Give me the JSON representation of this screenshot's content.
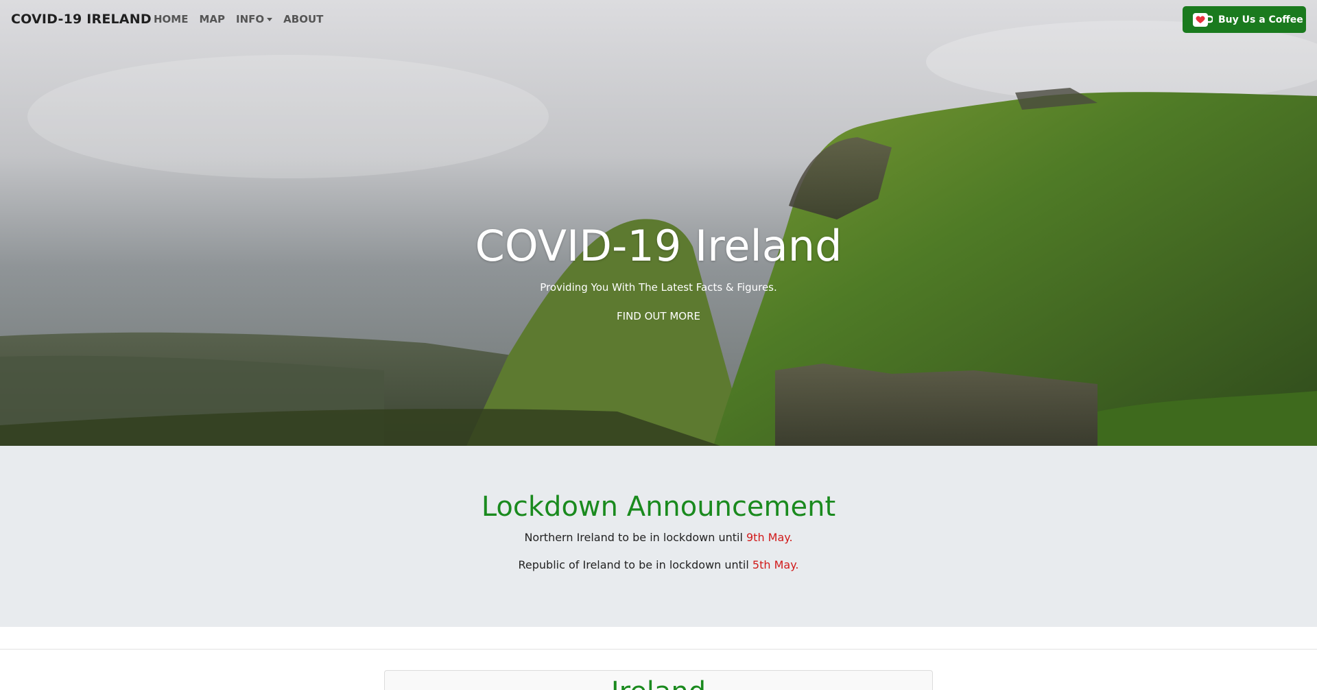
{
  "navbar": {
    "brand": "COVID-19 IRELAND",
    "links": [
      {
        "label": "HOME"
      },
      {
        "label": "MAP"
      },
      {
        "label": "INFO"
      },
      {
        "label": "ABOUT"
      }
    ],
    "coffee_button": {
      "label": "Buy Us a Coffee",
      "icon": "coffee-cup-heart-icon"
    }
  },
  "hero": {
    "title": "COVID-19 Ireland",
    "subtitle": "Providing You With The Latest Facts & Figures.",
    "cta": "FIND OUT MORE"
  },
  "lockdown": {
    "title": "Lockdown Announcement",
    "lines": [
      {
        "text": "Northern Ireland to be in lockdown until ",
        "date": "9th May."
      },
      {
        "text": "Republic of Ireland to be in lockdown until ",
        "date": "5th May."
      }
    ]
  },
  "card": {
    "title": "Ireland"
  },
  "colors": {
    "accent_green": "#1a8a1e",
    "button_green": "#1a7a1e",
    "date_red": "#d11a1a",
    "section_bg": "#e8ebee"
  }
}
